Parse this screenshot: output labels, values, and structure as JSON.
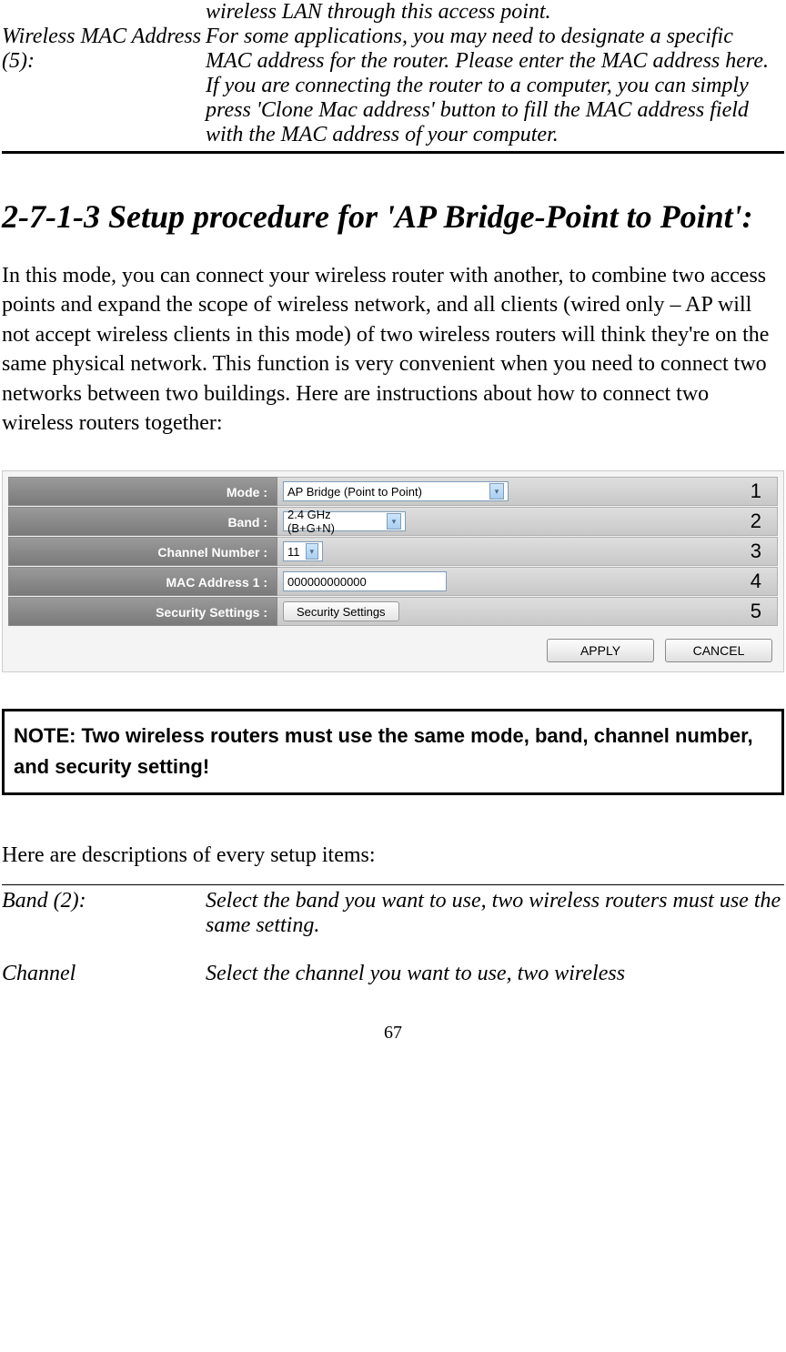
{
  "top_table": {
    "continuation_text": "wireless LAN through this access point.",
    "term": "Wireless MAC Address (5):",
    "def": "For some applications, you may need to designate a specific MAC address for the router. Please enter the MAC address here. If you are connecting the router to a computer, you can simply press 'Clone Mac address' button to fill the MAC address field with the MAC address of your computer."
  },
  "section_heading": "2-7-1-3 Setup procedure for 'AP Bridge-Point to Point':",
  "body_paragraph": "In this mode, you can connect your wireless router with another, to combine two access points and expand the scope of wireless network, and all clients (wired only – AP will not accept wireless clients in this mode) of two wireless routers will think they're on the same physical network. This function is very convenient when you need to connect two networks between two buildings. Here are instructions about how to connect two wireless routers together:",
  "config": {
    "rows": [
      {
        "label": "Mode :",
        "type": "select",
        "value": "AP Bridge (Point to Point)",
        "width": "mode",
        "callout": "1"
      },
      {
        "label": "Band :",
        "type": "select",
        "value": "2.4 GHz (B+G+N)",
        "width": "band",
        "callout": "2"
      },
      {
        "label": "Channel Number :",
        "type": "select",
        "value": "11",
        "width": "chan",
        "callout": "3"
      },
      {
        "label": "MAC Address 1 :",
        "type": "input",
        "value": "000000000000",
        "callout": "4"
      },
      {
        "label": "Security Settings :",
        "type": "button",
        "value": "Security Settings",
        "callout": "5"
      }
    ],
    "apply": "APPLY",
    "cancel": "CANCEL"
  },
  "note": "NOTE: Two wireless routers must use the same mode, band, channel number, and security setting!",
  "desc_intro": "Here are descriptions of every setup items:",
  "desc_table": [
    {
      "term": "Band (2):",
      "def": "Select the band you want to use, two wireless routers must use the same setting."
    },
    {
      "term": "Channel",
      "def": "Select the channel you want to use, two wireless"
    }
  ],
  "page_number": "67"
}
